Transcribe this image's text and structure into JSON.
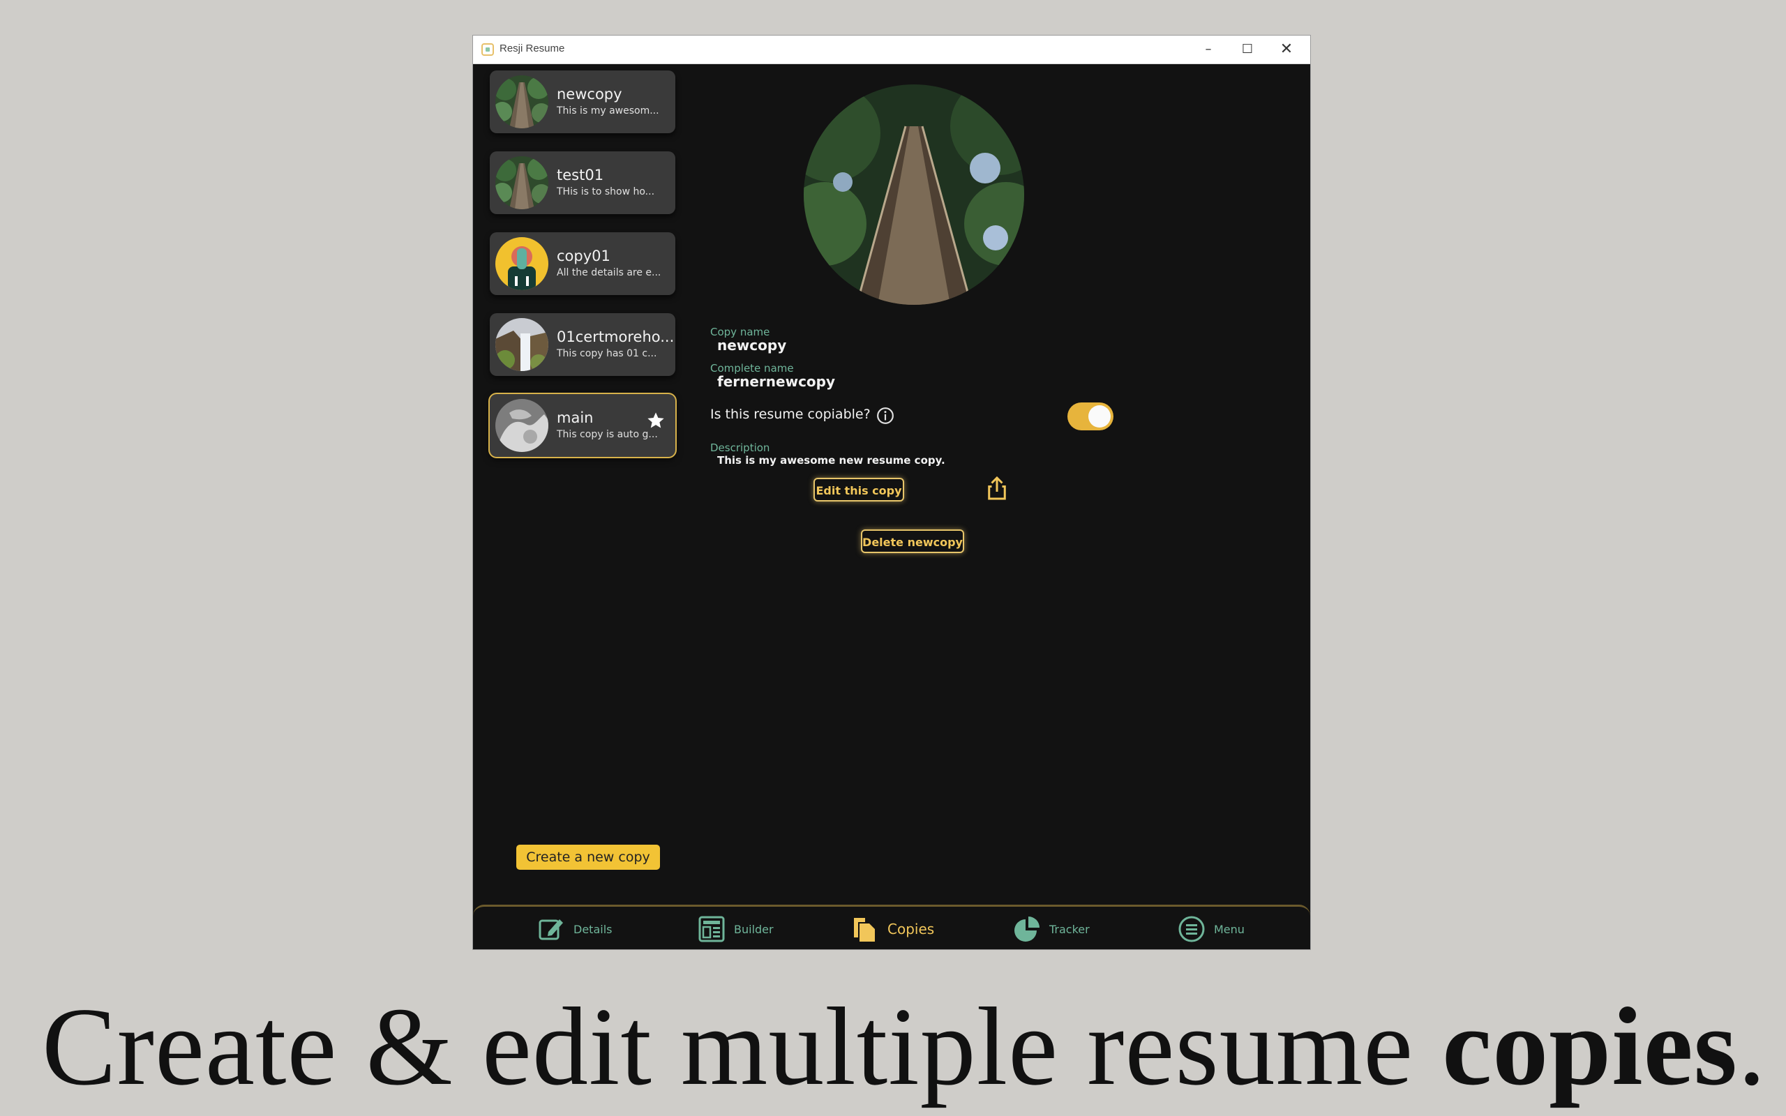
{
  "window": {
    "title": "Resji Resume",
    "min_glyph": "–",
    "max_glyph": "☐",
    "close_glyph": "✕"
  },
  "copies": [
    {
      "name": "newcopy",
      "desc": "This is my awesom...",
      "avatar": "bridge-forest"
    },
    {
      "name": "test01",
      "desc": "THis is to show ho...",
      "avatar": "bridge-forest"
    },
    {
      "name": "copy01",
      "desc": "All the details are e...",
      "avatar": "person-yellow"
    },
    {
      "name": "01certmoreho...",
      "desc": "This copy has 01 c...",
      "avatar": "waterfall"
    },
    {
      "name": "main",
      "desc": "This copy is auto g...",
      "avatar": "hands-bw",
      "starred": true
    }
  ],
  "detail": {
    "copy_name_label": "Copy name",
    "copy_name": "newcopy",
    "complete_name_label": "Complete name",
    "complete_name": "fernernewcopy",
    "copiable_question": "Is this resume copiable?",
    "copiable": true,
    "description_label": "Description",
    "description": "This is my awesome new resume copy.",
    "edit_button": "Edit this copy",
    "delete_button": "Delete newcopy"
  },
  "create_button": "Create a new copy",
  "nav": [
    {
      "label": "Details",
      "icon": "edit-icon"
    },
    {
      "label": "Builder",
      "icon": "builder-icon"
    },
    {
      "label": "Copies",
      "icon": "copies-icon",
      "active": true
    },
    {
      "label": "Tracker",
      "icon": "pie-chart-icon"
    },
    {
      "label": "Menu",
      "icon": "menu-icon"
    }
  ],
  "caption": {
    "regular": "Create & edit multiple resume ",
    "bold": "copies",
    "end": "."
  },
  "colors": {
    "accent": "#f2c335",
    "green": "#6fb59a",
    "background": "#121212",
    "card": "#3a3a3a"
  }
}
